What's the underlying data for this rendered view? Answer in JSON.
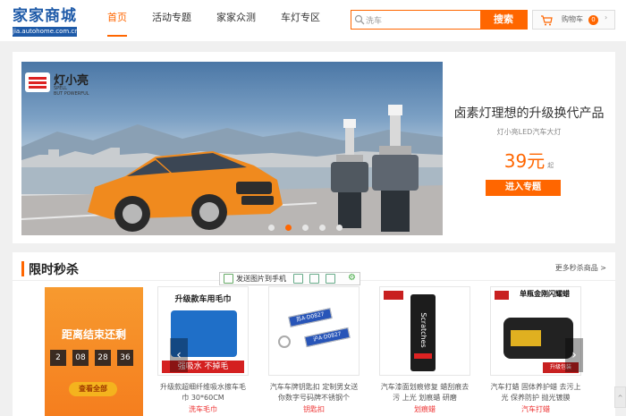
{
  "header": {
    "logo": {
      "main": "家家商城",
      "sub": "jia.autohome.com.cn"
    },
    "nav": [
      {
        "label": "首页",
        "active": true
      },
      {
        "label": "活动专题",
        "active": false
      },
      {
        "label": "家家众测",
        "active": false
      },
      {
        "label": "车灯专区",
        "active": false
      }
    ],
    "search": {
      "value": "洗车",
      "button": "搜索"
    },
    "cart": {
      "label": "购物车",
      "count": "0"
    }
  },
  "promo": {
    "brand": {
      "name": "灯小亮",
      "sub1": "SPELL",
      "sub2": "BUT POWERFUL"
    },
    "title": "卤素灯理想的升级换代产品",
    "subtitle": "灯小亮LED汽车大灯",
    "price": "39元",
    "price_unit": "起",
    "button": "进入专题",
    "slides": 5,
    "active_slide": 1
  },
  "flash": {
    "title": "限时秒杀",
    "more": "更多秒杀商品 >",
    "toolbar": {
      "send_label": "发送图片到手机"
    },
    "countdown": {
      "title": "距离结束还剩",
      "values": [
        "2",
        "08",
        "28",
        "36"
      ],
      "button": "查看全部"
    },
    "products": [
      {
        "name": "升级款超细纤维吸水擦车毛巾 30*60CM",
        "tag": "洗车毛巾",
        "img_title": "升级款车用毛巾",
        "img_slogan": "强吸水 不掉毛"
      },
      {
        "name": "汽车车牌钥匙扣 定制男女送你数字号码牌不锈钢个",
        "tag": "钥匙扣",
        "plate1": "苏A·D0827",
        "plate2": "沪A·D0827"
      },
      {
        "name": "汽车漆面划痕修复 蜡刮痕去污 上光 划痕蜡 研磨",
        "tag": "划痕蜡",
        "tube_text": "Scratches"
      },
      {
        "name": "汽车打蜡 固体养护蜡 去污上光 保养防护 抛光镀膜",
        "tag": "汽车打蜡",
        "img_title": "单瓶金刚闪耀蜡",
        "img_badge": "升级包装"
      }
    ]
  },
  "colors": {
    "accent": "#ff6600",
    "logo_blue": "#1e5aa8",
    "price_red": "#e33333"
  }
}
